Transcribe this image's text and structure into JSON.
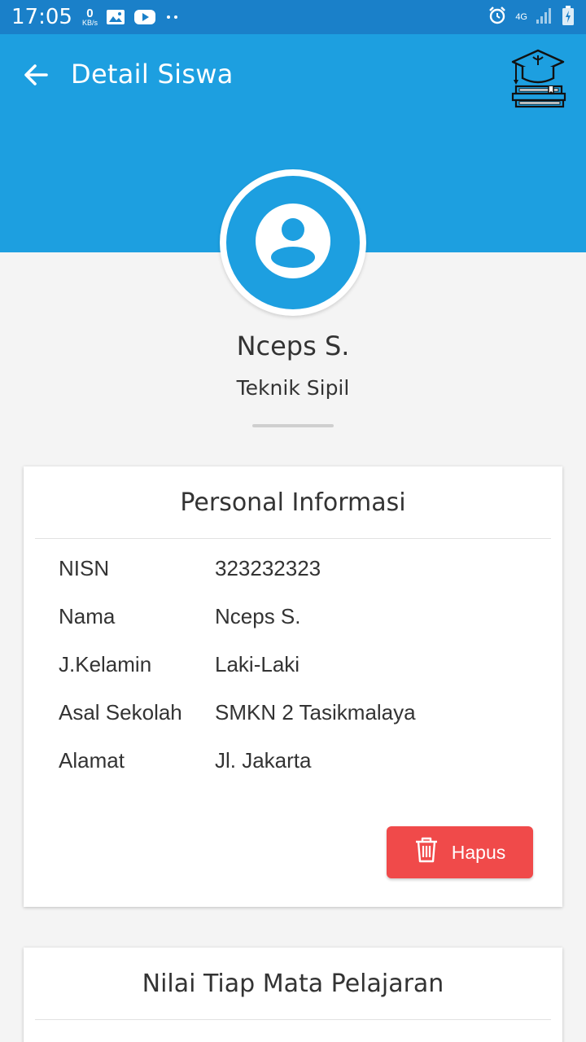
{
  "status_bar": {
    "time": "17:05",
    "speed_value": "0",
    "speed_unit": "KB/s",
    "network": "4G",
    "icons": [
      "image-icon",
      "youtube-icon",
      "dots-icon",
      "alarm-icon",
      "signal-icon",
      "battery-icon"
    ]
  },
  "app_bar": {
    "title": "Detail Siswa",
    "background_color": "#1d9fe0",
    "back_icon": "arrow-left-icon",
    "logo_icon": "graduation-books-icon"
  },
  "profile": {
    "name": "Nceps S.",
    "major": "Teknik Sipil",
    "avatar_icon": "account-circle-icon"
  },
  "personal_card": {
    "title": "Personal Informasi",
    "rows": [
      {
        "label": "NISN",
        "value": "323232323"
      },
      {
        "label": "Nama",
        "value": "Nceps S."
      },
      {
        "label": "J.Kelamin",
        "value": "Laki-Laki"
      },
      {
        "label": "Asal Sekolah",
        "value": "SMKN 2 Tasikmalaya"
      },
      {
        "label": "Alamat",
        "value": "Jl. Jakarta"
      }
    ],
    "delete_button": {
      "label": "Hapus",
      "icon": "trash-icon",
      "color": "#f04a4a"
    }
  },
  "grades_card": {
    "title": "Nilai Tiap Mata Pelajaran"
  }
}
